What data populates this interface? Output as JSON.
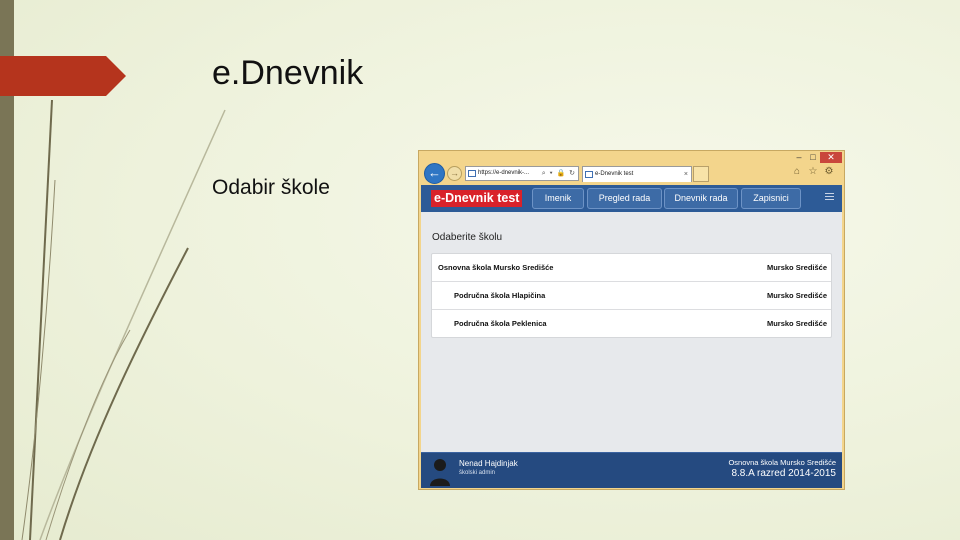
{
  "slide": {
    "title": "e.Dnevnik",
    "bullet": "Odabir škole"
  },
  "browser": {
    "address": "https://e-dnevnik-...",
    "address_tools": "⌕ ▾ 🔒 ↻",
    "tab_title": "e-Dnevnik test",
    "controls": {
      "minimize": "–",
      "maximize": "□",
      "close": "✕"
    },
    "icons": [
      "back-arrow-icon",
      "forward-arrow-icon",
      "home-icon",
      "star-icon",
      "gear-icon"
    ]
  },
  "app": {
    "logo": "e-Dnevnik test",
    "nav": [
      "Imenik",
      "Pregled rada",
      "Dnevnik rada",
      "Zapisnici"
    ],
    "page_heading": "Odaberite školu",
    "schools": [
      {
        "name": "Osnovna škola Mursko Središće",
        "place": "Mursko Središće"
      },
      {
        "name": "Područna škola Hlapičina",
        "place": "Mursko Središće"
      },
      {
        "name": "Područna škola Peklenica",
        "place": "Mursko Središće"
      }
    ],
    "footer": {
      "user_name": "Nenad Hajdinjak",
      "user_role": "školski admin",
      "school": "Osnovna škola Mursko Središće",
      "class": "8.8.A razred 2014-2015"
    }
  },
  "colors": {
    "accent_red": "#d9222a",
    "header_blue": "#2d5b97",
    "footer_blue": "#254a80",
    "frame_gold": "#f3d58c",
    "slide_arrow": "#b5341d"
  }
}
